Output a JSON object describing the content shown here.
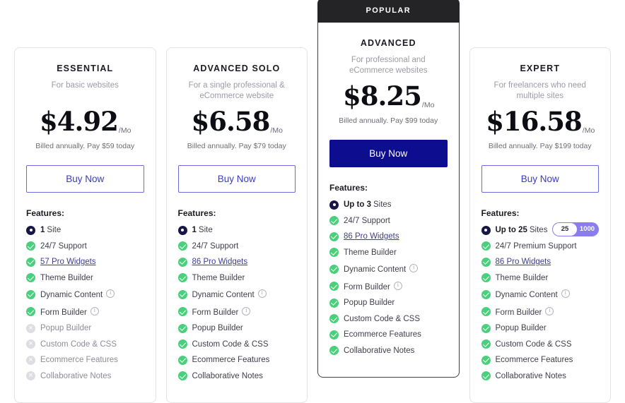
{
  "page": {
    "background": "#ffffff",
    "accent_outline": "#6b6be0",
    "accent_filled": "#0d0d8f",
    "check_color": "#4ad07d",
    "disabled_color": "#dedee2",
    "badge_color": "#242427",
    "slider_color": "#8b7cf0"
  },
  "labels": {
    "features_heading": "Features:",
    "buy_now": "Buy Now",
    "per_month": "/Mo"
  },
  "plans": [
    {
      "name": "ESSENTIAL",
      "description": "For basic websites",
      "price": "$4.92",
      "period": "/Mo",
      "billing": "Billed annually. Pay $59 today",
      "cta": "Buy Now",
      "popular": false,
      "badge": "",
      "features": [
        {
          "icon": "count-icon",
          "state": "count",
          "strong": "1",
          "label": "Site",
          "link": false,
          "info": false
        },
        {
          "icon": "check-icon",
          "state": "enabled",
          "strong": "",
          "label": "24/7 Support",
          "link": false,
          "info": false
        },
        {
          "icon": "check-icon",
          "state": "enabled",
          "strong": "",
          "label": "57 Pro Widgets",
          "link": true,
          "info": false
        },
        {
          "icon": "check-icon",
          "state": "enabled",
          "strong": "",
          "label": "Theme Builder",
          "link": false,
          "info": false
        },
        {
          "icon": "check-icon",
          "state": "enabled",
          "strong": "",
          "label": "Dynamic Content",
          "link": false,
          "info": true
        },
        {
          "icon": "check-icon",
          "state": "enabled",
          "strong": "",
          "label": "Form Builder",
          "link": false,
          "info": true
        },
        {
          "icon": "cross-icon",
          "state": "disabled",
          "strong": "",
          "label": "Popup Builder",
          "link": false,
          "info": false
        },
        {
          "icon": "cross-icon",
          "state": "disabled",
          "strong": "",
          "label": "Custom Code & CSS",
          "link": false,
          "info": false
        },
        {
          "icon": "cross-icon",
          "state": "disabled",
          "strong": "",
          "label": "Ecommerce Features",
          "link": false,
          "info": false
        },
        {
          "icon": "cross-icon",
          "state": "disabled",
          "strong": "",
          "label": "Collaborative Notes",
          "link": false,
          "info": false
        }
      ]
    },
    {
      "name": "ADVANCED SOLO",
      "description": "For a single professional & eCommerce website",
      "price": "$6.58",
      "period": "/Mo",
      "billing": "Billed annually. Pay $79 today",
      "cta": "Buy Now",
      "popular": false,
      "badge": "",
      "features": [
        {
          "icon": "count-icon",
          "state": "count",
          "strong": "1",
          "label": "Site",
          "link": false,
          "info": false
        },
        {
          "icon": "check-icon",
          "state": "enabled",
          "strong": "",
          "label": "24/7 Support",
          "link": false,
          "info": false
        },
        {
          "icon": "check-icon",
          "state": "enabled",
          "strong": "",
          "label": "86 Pro Widgets",
          "link": true,
          "info": false
        },
        {
          "icon": "check-icon",
          "state": "enabled",
          "strong": "",
          "label": "Theme Builder",
          "link": false,
          "info": false
        },
        {
          "icon": "check-icon",
          "state": "enabled",
          "strong": "",
          "label": "Dynamic Content",
          "link": false,
          "info": true
        },
        {
          "icon": "check-icon",
          "state": "enabled",
          "strong": "",
          "label": "Form Builder",
          "link": false,
          "info": true
        },
        {
          "icon": "check-icon",
          "state": "enabled",
          "strong": "",
          "label": "Popup Builder",
          "link": false,
          "info": false
        },
        {
          "icon": "check-icon",
          "state": "enabled",
          "strong": "",
          "label": "Custom Code & CSS",
          "link": false,
          "info": false
        },
        {
          "icon": "check-icon",
          "state": "enabled",
          "strong": "",
          "label": "Ecommerce Features",
          "link": false,
          "info": false
        },
        {
          "icon": "check-icon",
          "state": "enabled",
          "strong": "",
          "label": "Collaborative Notes",
          "link": false,
          "info": false
        }
      ]
    },
    {
      "name": "ADVANCED",
      "description": "For professional and eCommerce websites",
      "price": "$8.25",
      "period": "/Mo",
      "billing": "Billed annually. Pay $99 today",
      "cta": "Buy Now",
      "popular": true,
      "badge": "POPULAR",
      "features": [
        {
          "icon": "count-icon",
          "state": "count",
          "strong": "Up to 3",
          "label": "Sites",
          "link": false,
          "info": false
        },
        {
          "icon": "check-icon",
          "state": "enabled",
          "strong": "",
          "label": "24/7 Support",
          "link": false,
          "info": false
        },
        {
          "icon": "check-icon",
          "state": "enabled",
          "strong": "",
          "label": "86 Pro Widgets",
          "link": true,
          "info": false
        },
        {
          "icon": "check-icon",
          "state": "enabled",
          "strong": "",
          "label": "Theme Builder",
          "link": false,
          "info": false
        },
        {
          "icon": "check-icon",
          "state": "enabled",
          "strong": "",
          "label": "Dynamic Content",
          "link": false,
          "info": true
        },
        {
          "icon": "check-icon",
          "state": "enabled",
          "strong": "",
          "label": "Form Builder",
          "link": false,
          "info": true
        },
        {
          "icon": "check-icon",
          "state": "enabled",
          "strong": "",
          "label": "Popup Builder",
          "link": false,
          "info": false
        },
        {
          "icon": "check-icon",
          "state": "enabled",
          "strong": "",
          "label": "Custom Code & CSS",
          "link": false,
          "info": false
        },
        {
          "icon": "check-icon",
          "state": "enabled",
          "strong": "",
          "label": "Ecommerce Features",
          "link": false,
          "info": false
        },
        {
          "icon": "check-icon",
          "state": "enabled",
          "strong": "",
          "label": "Collaborative Notes",
          "link": false,
          "info": false
        }
      ]
    },
    {
      "name": "EXPERT",
      "description": "For freelancers who need multiple sites",
      "price": "$16.58",
      "period": "/Mo",
      "billing": "Billed annually. Pay $199 today",
      "cta": "Buy Now",
      "popular": false,
      "badge": "",
      "slider": {
        "value": "25",
        "max": "1000"
      },
      "features": [
        {
          "icon": "count-icon",
          "state": "count",
          "strong": "Up to 25",
          "label": "Sites",
          "link": false,
          "info": false,
          "slider": true
        },
        {
          "icon": "check-icon",
          "state": "enabled",
          "strong": "",
          "label": "24/7 Premium Support",
          "link": false,
          "info": false
        },
        {
          "icon": "check-icon",
          "state": "enabled",
          "strong": "",
          "label": "86 Pro Widgets",
          "link": true,
          "info": false
        },
        {
          "icon": "check-icon",
          "state": "enabled",
          "strong": "",
          "label": "Theme Builder",
          "link": false,
          "info": false
        },
        {
          "icon": "check-icon",
          "state": "enabled",
          "strong": "",
          "label": "Dynamic Content",
          "link": false,
          "info": true
        },
        {
          "icon": "check-icon",
          "state": "enabled",
          "strong": "",
          "label": "Form Builder",
          "link": false,
          "info": true
        },
        {
          "icon": "check-icon",
          "state": "enabled",
          "strong": "",
          "label": "Popup Builder",
          "link": false,
          "info": false
        },
        {
          "icon": "check-icon",
          "state": "enabled",
          "strong": "",
          "label": "Custom Code & CSS",
          "link": false,
          "info": false
        },
        {
          "icon": "check-icon",
          "state": "enabled",
          "strong": "",
          "label": "Ecommerce Features",
          "link": false,
          "info": false
        },
        {
          "icon": "check-icon",
          "state": "enabled",
          "strong": "",
          "label": "Collaborative Notes",
          "link": false,
          "info": false
        }
      ]
    }
  ]
}
